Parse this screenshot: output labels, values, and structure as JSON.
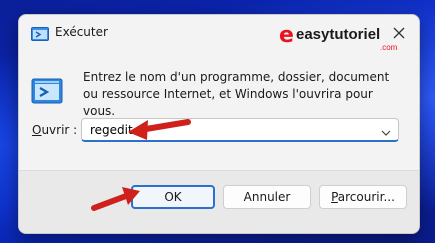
{
  "window": {
    "title": "Exécuter",
    "icon": "run-icon"
  },
  "watermark": {
    "letter": "e",
    "text": "easytutoriel",
    "domain": ".com"
  },
  "body": {
    "app_icon": "run-app-icon",
    "description": "Entrez le nom d'un programme, dossier, document ou ressource Internet, et Windows l'ouvrira pour vous."
  },
  "open": {
    "label_accel": "O",
    "label_rest": "uvrir :",
    "value": "regedit"
  },
  "buttons": {
    "ok": "OK",
    "cancel": "Annuler",
    "browse_accel": "P",
    "browse_rest": "arcourir..."
  },
  "colors": {
    "accent": "#2b6fcf",
    "arrow": "#d0201c",
    "brand": "#e8141f"
  }
}
